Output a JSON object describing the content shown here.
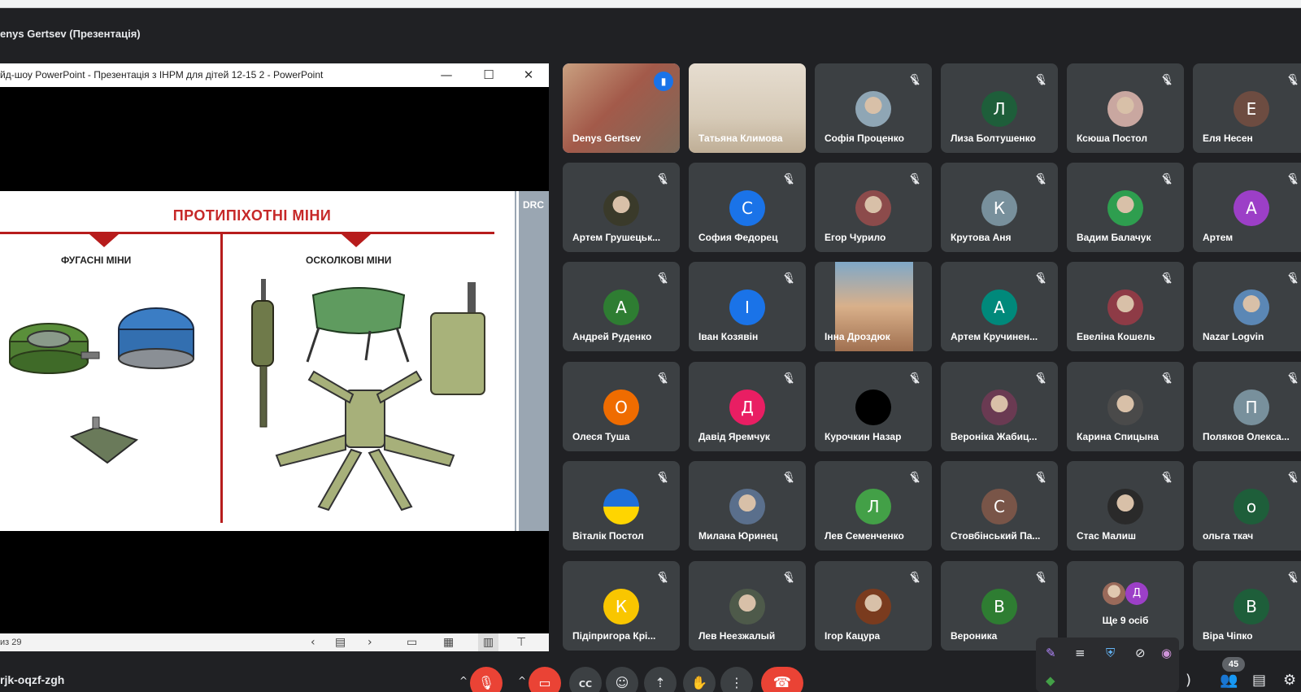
{
  "presenter_title": "enys Gertsev (Презентація)",
  "ppt": {
    "window_title": "йд-шоу PowerPoint  -  Презентація з ІНРМ для дітей 12-15 2 - PowerPoint",
    "minimize": "—",
    "maximize": "☐",
    "close": "✕",
    "status_page": "из 29",
    "slide": {
      "heading": "ПРОТИПІХОТНІ МІНИ",
      "left_heading": "ФУГАСНІ МІНИ",
      "right_heading": "ОСКОЛКОВІ МІНИ",
      "logo": "DRC"
    }
  },
  "participants": [
    {
      "name": "Denys Gertsev",
      "type": "video",
      "active": true
    },
    {
      "name": "Татьяна Климова",
      "type": "video"
    },
    {
      "name": "Софія Проценко",
      "type": "photo",
      "color": "#8fa6b5"
    },
    {
      "name": "Лиза Болтушенко",
      "type": "letter",
      "letter": "Л",
      "color": "#1e5e3a"
    },
    {
      "name": "Ксюша Постол",
      "type": "photo",
      "color": "#c9a7a0"
    },
    {
      "name": "Еля Несен",
      "type": "letter",
      "letter": "Е",
      "color": "#6d4c41"
    },
    {
      "name": "Артем Грушецьк...",
      "type": "photo",
      "color": "#3a3a2a"
    },
    {
      "name": "София Федорец",
      "type": "letter",
      "letter": "С",
      "color": "#1a73e8"
    },
    {
      "name": "Егор Чурило",
      "type": "photo",
      "color": "#8c4b4b"
    },
    {
      "name": "Крутова Аня",
      "type": "letter",
      "letter": "К",
      "color": "#78909c"
    },
    {
      "name": "Вадим Балачук",
      "type": "photo",
      "color": "#2e9e4f"
    },
    {
      "name": "Артем",
      "type": "letter",
      "letter": "А",
      "color": "#9c3fc7"
    },
    {
      "name": "Андрей Руденко",
      "type": "letter",
      "letter": "А",
      "color": "#2e7d32"
    },
    {
      "name": "Іван Козявін",
      "type": "letter",
      "letter": "І",
      "color": "#1a73e8"
    },
    {
      "name": "Інна Дроздюк",
      "type": "video"
    },
    {
      "name": "Артем Кручинен...",
      "type": "letter",
      "letter": "А",
      "color": "#00897b"
    },
    {
      "name": "Евеліна Кошель",
      "type": "photo",
      "color": "#8e3b46"
    },
    {
      "name": "Nazar Logvin",
      "type": "photo",
      "color": "#5b87b5"
    },
    {
      "name": "Олеся Туша",
      "type": "letter",
      "letter": "О",
      "color": "#ef6c00"
    },
    {
      "name": "Давід Яремчук",
      "type": "letter",
      "letter": "Д",
      "color": "#e91e63"
    },
    {
      "name": "Курочкин Назар",
      "type": "photo",
      "color": "#000000"
    },
    {
      "name": "Вероніка Жабиц...",
      "type": "photo",
      "color": "#6a3a52"
    },
    {
      "name": "Карина Спицына",
      "type": "photo",
      "color": "#4a4a4a"
    },
    {
      "name": "Поляков Олекса...",
      "type": "letter",
      "letter": "П",
      "color": "#78909c"
    },
    {
      "name": "Віталік Постол",
      "type": "flag"
    },
    {
      "name": "Милана Юринец",
      "type": "photo",
      "color": "#5a6f8c"
    },
    {
      "name": "Лев Семенченко",
      "type": "letter",
      "letter": "Л",
      "color": "#43a047"
    },
    {
      "name": "Стовбінський Па...",
      "type": "letter",
      "letter": "С",
      "color": "#795548"
    },
    {
      "name": "Стас Малиш",
      "type": "photo",
      "color": "#2a2a2a"
    },
    {
      "name": "ольга ткач",
      "type": "letter",
      "letter": "о",
      "color": "#1e5e3a"
    },
    {
      "name": "Підіпригора Крі...",
      "type": "letter",
      "letter": "К",
      "color": "#f9c600"
    },
    {
      "name": "Лев Неезжалый",
      "type": "photo",
      "color": "#4e5a4a"
    },
    {
      "name": "Ігор Кацура",
      "type": "photo",
      "color": "#7a3b1e"
    },
    {
      "name": "Вероника",
      "type": "letter",
      "letter": "В",
      "color": "#2e7d32"
    },
    {
      "name": "Ще 9 осіб",
      "type": "more",
      "letter": "Д",
      "color": "#9c3fc7"
    },
    {
      "name": "Віра Чіпко",
      "type": "letter",
      "letter": "В",
      "color": "#1e5e3a"
    }
  ],
  "bottom": {
    "meeting_code": "rjk-oqzf-zgh",
    "people_count": "45"
  }
}
